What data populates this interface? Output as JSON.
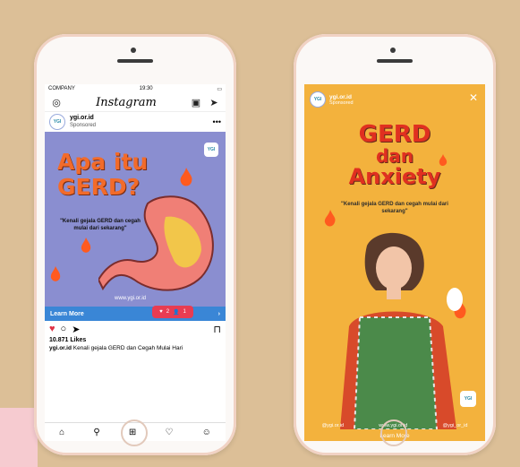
{
  "feed": {
    "status": {
      "carrier": "COMPANY",
      "time": "19:30"
    },
    "app_name": "Instagram",
    "post": {
      "account": "ygi.or.id",
      "sponsored": "Sponsored",
      "badge": "YGI",
      "title_line1": "Apa itu",
      "title_line2": "GERD?",
      "subtitle": "\"Kenali gejala GERD dan cegah mulai dari sekarang\"",
      "url": "www.ygi.or.id",
      "cta": "Learn More",
      "likes": "10.871 Likes",
      "caption_user": "ygi.or.id",
      "caption_text": "Kenali gejala GERD dan Cegah Mulai Hari"
    },
    "notification": {
      "hearts": "2",
      "follows": "1"
    }
  },
  "story": {
    "account": "ygi.or.id",
    "sponsored": "Sponsored",
    "title_1": "GERD",
    "title_2": "dan",
    "title_3": "Anxiety",
    "subtitle": "\"Kenali gejala GERD dan cegah mulai dari sekarang\"",
    "footer_ig": "@ygi.or.id",
    "footer_web": "www.ygi.or.id",
    "footer_tw": "@ygi_or_id",
    "badge": "YGI",
    "cta": "Learn More"
  },
  "colors": {
    "background": "#dcbf97",
    "post_bg": "#8a8ed0",
    "title_orange": "#f26b2a",
    "story_bg": "#f3b23d",
    "cta_blue": "#3a86d6"
  }
}
